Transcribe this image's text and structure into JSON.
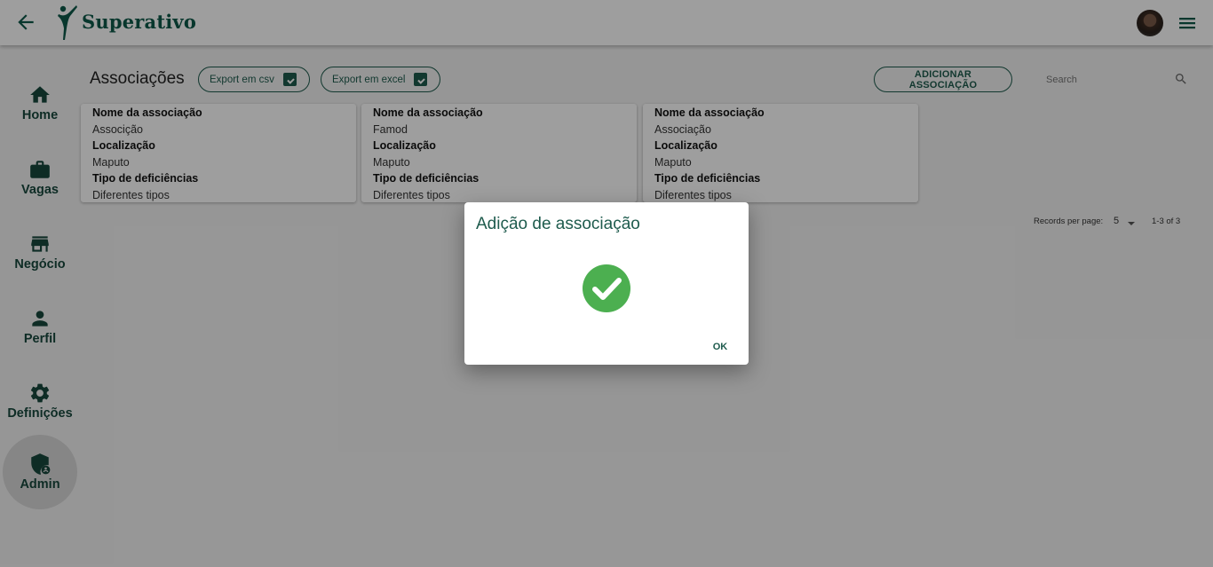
{
  "header": {
    "brand": "Superativo",
    "back_icon": "arrow-left-icon",
    "menu_icon": "hamburger-menu-icon",
    "accent_color": "#0e5a4a"
  },
  "sidebar": {
    "items": [
      {
        "label": "Home",
        "icon": "home-icon"
      },
      {
        "label": "Vagas",
        "icon": "briefcase-icon"
      },
      {
        "label": "Negócio",
        "icon": "store-icon"
      },
      {
        "label": "Perfil",
        "icon": "person-icon"
      },
      {
        "label": "Definições",
        "icon": "gear-icon"
      },
      {
        "label": "Admin",
        "icon": "admin-shield-icon",
        "active": true
      }
    ]
  },
  "main": {
    "title": "Associações",
    "export_csv": "Export em csv",
    "export_excel": "Export em excel",
    "add_button": "ADICIONAR ASSOCIAÇÃO",
    "search_placeholder": "Search",
    "cards": [
      {
        "name_label": "Nome da associação",
        "name": "Associção",
        "location_label": "Localização",
        "location": "Maputo",
        "type_label": "Tipo de deficiências",
        "type": "Diferentes tipos"
      },
      {
        "name_label": "Nome da associação",
        "name": "Famod",
        "location_label": "Localização",
        "location": "Maputo",
        "type_label": "Tipo de deficiências",
        "type": "Diferentes tipos"
      },
      {
        "name_label": "Nome da associação",
        "name": "Associação",
        "location_label": "Localização",
        "location": "Maputo",
        "type_label": "Tipo de deficiências",
        "type": "Diferentes tipos"
      }
    ],
    "pagination": {
      "records_label": "Records per page:",
      "per_page": "5",
      "range": "1-3 of 3"
    }
  },
  "dialog": {
    "title": "Adição de associação",
    "icon": "check-circle-icon",
    "success_color": "#4caf50",
    "ok_label": "OK"
  }
}
